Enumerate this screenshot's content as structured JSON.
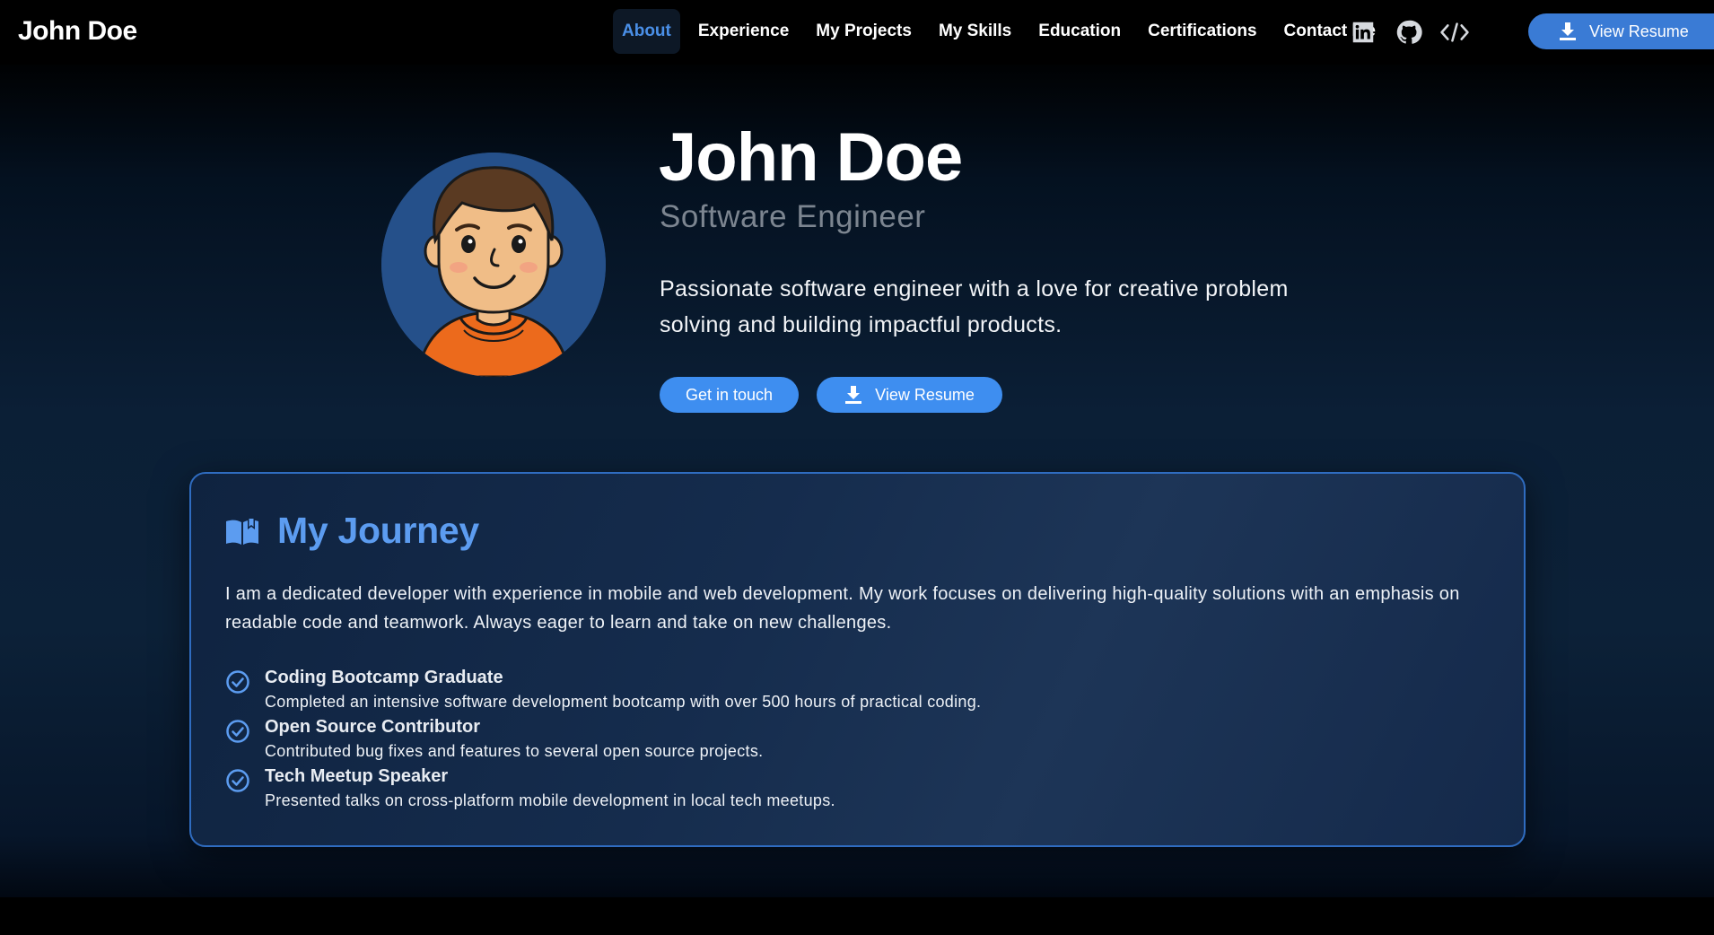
{
  "header": {
    "brand": "John Doe",
    "nav": [
      {
        "label": "About",
        "active": true
      },
      {
        "label": "Experience"
      },
      {
        "label": "My Projects"
      },
      {
        "label": "My Skills"
      },
      {
        "label": "Education"
      },
      {
        "label": "Certifications"
      },
      {
        "label": "Contact Me"
      }
    ],
    "icons": [
      "linkedin-icon",
      "github-icon",
      "code-icon",
      "moon-icon"
    ],
    "resume_label": "View Resume"
  },
  "hero": {
    "name": "John Doe",
    "role": "Software Engineer",
    "description": "Passionate software engineer with a love for creative problem solving and building impactful products.",
    "primary_button": "Get in touch",
    "secondary_button": "View Resume"
  },
  "journey": {
    "title": "My Journey",
    "text": "I am a dedicated developer with experience in mobile and web development. My work focuses on delivering high-quality solutions with an emphasis on readable code and teamwork. Always eager to learn and take on new challenges.",
    "achievements": [
      {
        "title": "Coding Bootcamp Graduate",
        "description": "Completed an intensive software development bootcamp with over 500 hours of practical coding."
      },
      {
        "title": "Open Source Contributor",
        "description": "Contributed bug fixes and features to several open source projects."
      },
      {
        "title": "Tech Meetup Speaker",
        "description": "Presented talks on cross-platform mobile development in local tech meetups."
      }
    ]
  },
  "colors": {
    "accent": "#3e8ef0",
    "accent_text": "#5c9cf0",
    "muted": "#7c8590",
    "card_border": "#2f6cc0"
  }
}
